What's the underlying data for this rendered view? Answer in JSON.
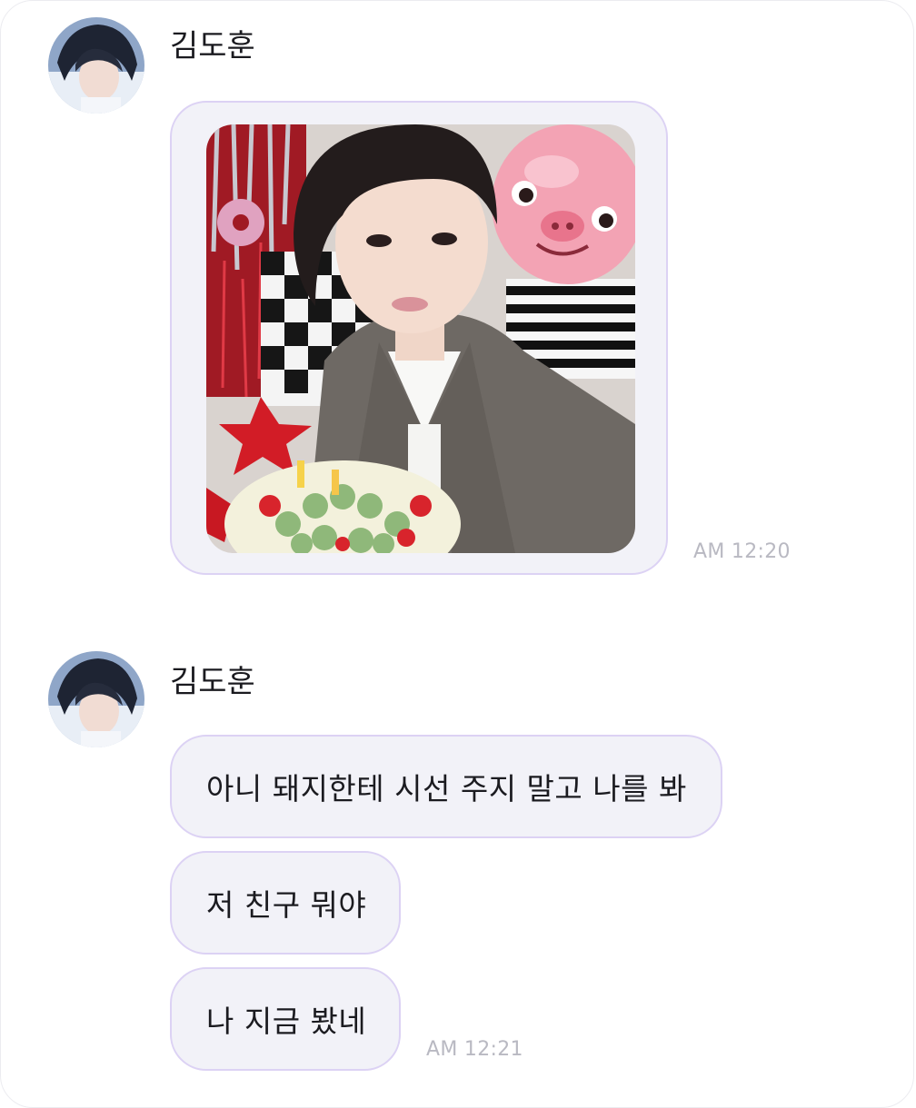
{
  "messages": [
    {
      "sender": "김도훈",
      "avatar_icon": "profile-photo",
      "attachment": "photo",
      "time": "AM 12:20"
    },
    {
      "sender": "김도훈",
      "avatar_icon": "profile-photo",
      "bubbles": [
        "아니 돼지한테 시선 주지 말고 나를 봐",
        "저 친구 뭐야",
        "나 지금 봤네"
      ],
      "time": "AM 12:21"
    }
  ],
  "colors": {
    "bubble_background": "#f2f2f8",
    "bubble_border": "#dcd2f4",
    "timestamp": "#b9b9c2",
    "name_text": "#1a1a1f"
  }
}
